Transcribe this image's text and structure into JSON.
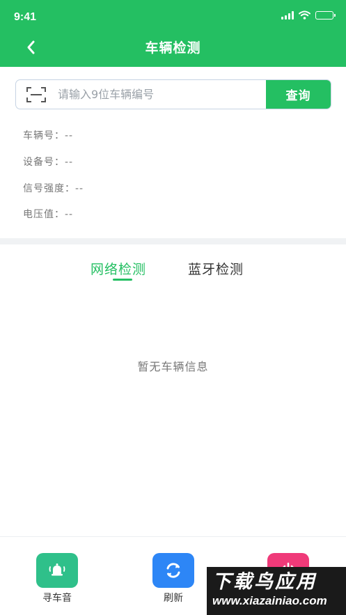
{
  "status_bar": {
    "time": "9:41"
  },
  "header": {
    "title": "车辆检测"
  },
  "search": {
    "placeholder": "请输入9位车辆编号",
    "value": "",
    "button_label": "查询"
  },
  "info": [
    {
      "label": "车辆号：",
      "value": "--"
    },
    {
      "label": "设备号：",
      "value": "--"
    },
    {
      "label": "信号强度：",
      "value": "--"
    },
    {
      "label": "电压值：",
      "value": "--"
    }
  ],
  "tabs": [
    {
      "label": "网络检测",
      "active": true
    },
    {
      "label": "蓝牙检测",
      "active": false
    }
  ],
  "empty_state": "暂无车辆信息",
  "bottom_actions": [
    {
      "label": "寻车音",
      "icon": "bell-icon",
      "color": "#2fc08a"
    },
    {
      "label": "刷新",
      "icon": "refresh-icon",
      "color": "#2d86f6"
    },
    {
      "label": "",
      "icon": "power-icon",
      "color": "#ef3a79"
    }
  ],
  "watermark": {
    "title": "下载鸟应用",
    "url": "www.xiazainiao.com"
  },
  "colors": {
    "primary": "#24bf62",
    "divider": "#f0f2f4"
  }
}
